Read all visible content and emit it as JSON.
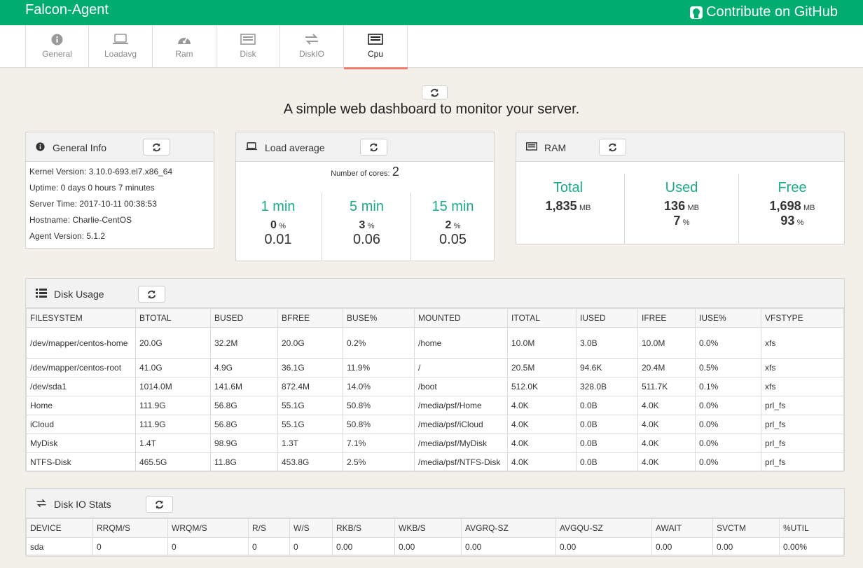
{
  "app": {
    "brand": "Falcon-Agent",
    "github_link": "Contribute on GitHub"
  },
  "tabs": [
    {
      "label": "General",
      "icon": "info-icon"
    },
    {
      "label": "Loadavg",
      "icon": "laptop-icon"
    },
    {
      "label": "Ram",
      "icon": "dashboard-icon"
    },
    {
      "label": "Disk",
      "icon": "disk-icon"
    },
    {
      "label": "DiskIO",
      "icon": "exchange-icon"
    },
    {
      "label": "Cpu",
      "icon": "list-icon",
      "active": true
    }
  ],
  "tagline": "A simple web dashboard to monitor your server.",
  "general": {
    "title": "General Info",
    "lines": [
      "Kernel Version: 3.10.0-693.el7.x86_64",
      "Uptime: 0 days 0 hours 7 minutes",
      "Server Time: 2017-10-11 00:38:53",
      "Hostname: Charlie-CentOS",
      "Agent Version: 5.1.2"
    ]
  },
  "loadavg": {
    "title": "Load average",
    "cores_label": "Number of cores:",
    "cores": "2",
    "cols": [
      {
        "label": "1 min",
        "pct": "0",
        "pct_unit": "%",
        "value": "0.01"
      },
      {
        "label": "5 min",
        "pct": "3",
        "pct_unit": "%",
        "value": "0.06"
      },
      {
        "label": "15 min",
        "pct": "2",
        "pct_unit": "%",
        "value": "0.05"
      }
    ]
  },
  "ram": {
    "title": "RAM",
    "cols": [
      {
        "label": "Total",
        "mb": "1,835",
        "mb_unit": "MB",
        "pct": "",
        "pct_unit": ""
      },
      {
        "label": "Used",
        "mb": "136",
        "mb_unit": "MB",
        "pct": "7",
        "pct_unit": "%"
      },
      {
        "label": "Free",
        "mb": "1,698",
        "mb_unit": "MB",
        "pct": "93",
        "pct_unit": "%"
      }
    ]
  },
  "disk": {
    "title": "Disk Usage",
    "headers": [
      "FILESYSTEM",
      "BTOTAL",
      "BUSED",
      "BFREE",
      "BUSE%",
      "MOUNTED",
      "ITOTAL",
      "IUSED",
      "IFREE",
      "IUSE%",
      "VFSTYPE"
    ],
    "rows": [
      [
        "/dev/mapper/centos-home",
        "20.0G",
        "32.2M",
        "20.0G",
        "0.2%",
        "/home",
        "10.0M",
        "3.0B",
        "10.0M",
        "0.0%",
        "xfs"
      ],
      [
        "/dev/mapper/centos-root",
        "41.0G",
        "4.9G",
        "36.1G",
        "11.9%",
        "/",
        "20.5M",
        "94.6K",
        "20.4M",
        "0.5%",
        "xfs"
      ],
      [
        "/dev/sda1",
        "1014.0M",
        "141.6M",
        "872.4M",
        "14.0%",
        "/boot",
        "512.0K",
        "328.0B",
        "511.7K",
        "0.1%",
        "xfs"
      ],
      [
        "Home",
        "111.9G",
        "56.8G",
        "55.1G",
        "50.8%",
        "/media/psf/Home",
        "4.0K",
        "0.0B",
        "4.0K",
        "0.0%",
        "prl_fs"
      ],
      [
        "iCloud",
        "111.9G",
        "56.8G",
        "55.1G",
        "50.8%",
        "/media/psf/iCloud",
        "4.0K",
        "0.0B",
        "4.0K",
        "0.0%",
        "prl_fs"
      ],
      [
        "MyDisk",
        "1.4T",
        "98.9G",
        "1.3T",
        "7.1%",
        "/media/psf/MyDisk",
        "4.0K",
        "0.0B",
        "4.0K",
        "0.0%",
        "prl_fs"
      ],
      [
        "NTFS-Disk",
        "465.5G",
        "11.8G",
        "453.8G",
        "2.5%",
        "/media/psf/NTFS-Disk",
        "4.0K",
        "0.0B",
        "4.0K",
        "0.0%",
        "prl_fs"
      ]
    ]
  },
  "diskio": {
    "title": "Disk IO Stats",
    "headers": [
      "DEVICE",
      "RRQM/S",
      "WRQM/S",
      "R/S",
      "W/S",
      "RKB/S",
      "WKB/S",
      "AVGRQ-SZ",
      "AVGQU-SZ",
      "AWAIT",
      "SVCTM",
      "%UTIL"
    ],
    "rows": [
      [
        "sda",
        "0",
        "0",
        "0",
        "0",
        "0.00",
        "0.00",
        "0.00",
        "0.00",
        "0.00",
        "0.00",
        "0.00%"
      ]
    ]
  }
}
